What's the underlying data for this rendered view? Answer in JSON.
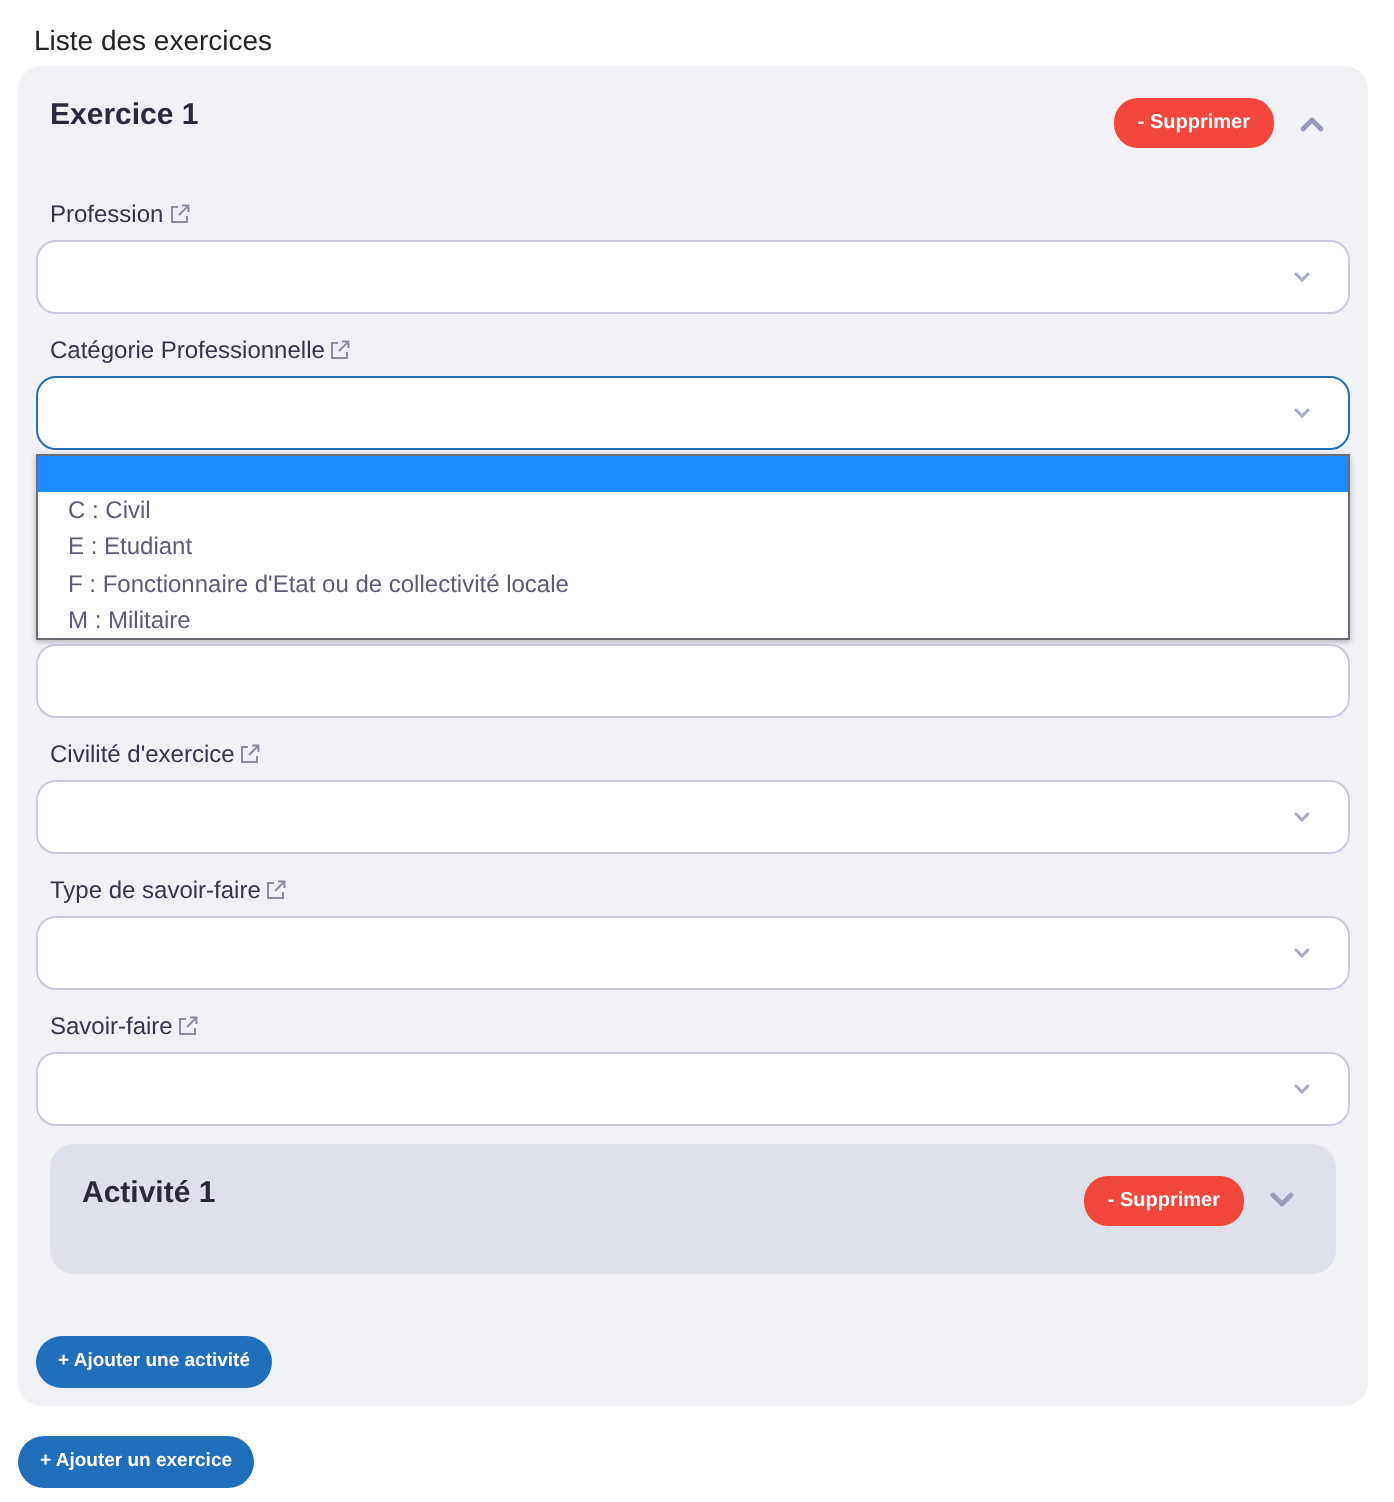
{
  "heading": "Liste des exercices",
  "exercises": [
    {
      "title": "Exercice 1",
      "delete_label": "- Supprimer",
      "expanded": true,
      "fields": [
        {
          "kind": "select",
          "label": "Profession",
          "focused": false,
          "expanded": false
        },
        {
          "kind": "select",
          "label": "Catégorie Professionnelle",
          "focused": true,
          "expanded": true,
          "options": [
            {
              "selected": true
            },
            {
              "label": "C : Civil",
              "selected": false
            },
            {
              "label": "E : Etudiant",
              "selected": false
            },
            {
              "label": "F : Fonctionnaire d'Etat ou de collectivité locale",
              "selected": false
            },
            {
              "label": "M : Militaire",
              "selected": false
            }
          ]
        },
        {
          "kind": "text",
          "focused": false
        },
        {
          "kind": "select",
          "label": "Civilité d'exercice",
          "focused": false,
          "expanded": false
        },
        {
          "kind": "select",
          "label": "Type de savoir-faire",
          "focused": false,
          "expanded": false
        },
        {
          "kind": "select",
          "label": "Savoir-faire",
          "focused": false,
          "expanded": false
        }
      ],
      "activities": [
        {
          "title": "Activité 1",
          "delete_label": "- Supprimer",
          "expanded": false
        }
      ],
      "add_activity_label": "+ Ajouter une activité"
    }
  ],
  "add_exercise_label": "+ Ajouter un exercice"
}
